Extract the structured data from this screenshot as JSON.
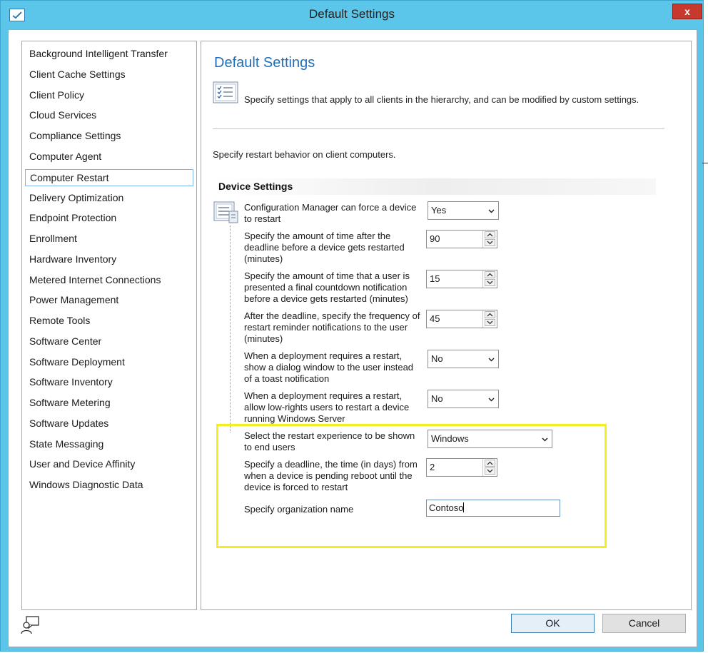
{
  "window": {
    "title": "Default Settings",
    "close_label": "x"
  },
  "sidebar": {
    "items": [
      "Background Intelligent Transfer",
      "Client Cache Settings",
      "Client Policy",
      "Cloud Services",
      "Compliance Settings",
      "Computer Agent",
      "Computer Restart",
      "Delivery Optimization",
      "Endpoint Protection",
      "Enrollment",
      "Hardware Inventory",
      "Metered Internet Connections",
      "Power Management",
      "Remote Tools",
      "Software Center",
      "Software Deployment",
      "Software Inventory",
      "Software Metering",
      "Software Updates",
      "State Messaging",
      "User and Device Affinity",
      "Windows Diagnostic Data"
    ],
    "selected": "Computer Restart"
  },
  "main": {
    "title": "Default Settings",
    "header_description": "Specify settings that apply to all clients in the hierarchy, and can be modified by custom settings.",
    "sub_description": "Specify restart behavior on client computers.",
    "section_title": "Device Settings"
  },
  "settings": [
    {
      "label": "Configuration Manager can force a device to restart",
      "value": "Yes"
    },
    {
      "label": "Specify the amount of time after the deadline before a device gets restarted (minutes)",
      "value": "90"
    },
    {
      "label": "Specify the amount of time that a user is presented a final countdown notification before a device gets restarted (minutes)",
      "value": "15"
    },
    {
      "label": "After the deadline, specify the frequency of restart reminder notifications to the user (minutes)",
      "value": "45"
    },
    {
      "label": "When a deployment requires a restart, show a dialog window to the user instead of a toast notification",
      "value": "No"
    },
    {
      "label": "When a deployment requires a restart, allow low-rights users to restart a device running Windows Server",
      "value": "No"
    },
    {
      "label": "Select the restart experience to be shown to end users",
      "value": "Windows"
    },
    {
      "label": "Specify a deadline, the time (in days) from when a device is pending reboot until the device is forced to restart",
      "value": "2"
    },
    {
      "label": "Specify organization name",
      "value": "Contoso"
    }
  ],
  "buttons": {
    "ok": "OK",
    "cancel": "Cancel"
  },
  "colors": {
    "titlebar": "#5bc6ea",
    "accent_title": "#1e6fb8",
    "highlight": "#f5ee1f",
    "close": "#c7392d"
  },
  "icons": [
    "app-check-icon",
    "close-icon",
    "settings-list-icon",
    "chevron-down-icon",
    "spin-up-icon",
    "spin-down-icon",
    "help-person-icon"
  ]
}
